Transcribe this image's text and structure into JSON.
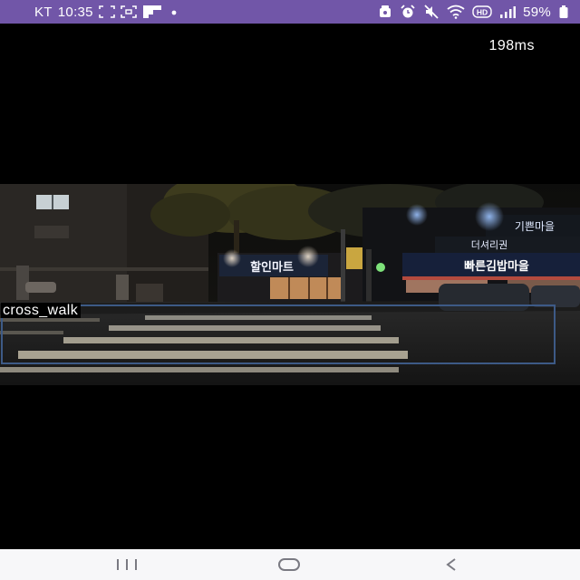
{
  "status_bar": {
    "carrier": "KT",
    "time": "10:35",
    "battery_percent": "59%",
    "icons_left": [
      "scan-frame-icon",
      "screenshot-icon",
      "flipboard-icon",
      "dot-icon"
    ],
    "icons_right": [
      "lock-icon",
      "alarm-icon",
      "mute-icon",
      "wifi-icon",
      "hd-icon",
      "signal-icon",
      "battery-icon"
    ],
    "hd_label": "HD",
    "background_color": "#7156a8"
  },
  "camera": {
    "inference_time": "198ms",
    "detections": [
      {
        "label": "cross_walk",
        "box_color": "#3d5a86"
      }
    ],
    "scene": {
      "sign_left": "할인마트",
      "sign_right_1": "더셔리권",
      "sign_right_2": "빠른김밥마을",
      "sign_right_3": "기쁜마을"
    }
  },
  "nav_bar": {
    "buttons": [
      "recent-apps",
      "home",
      "back"
    ],
    "background_color": "#f7f7f9"
  }
}
